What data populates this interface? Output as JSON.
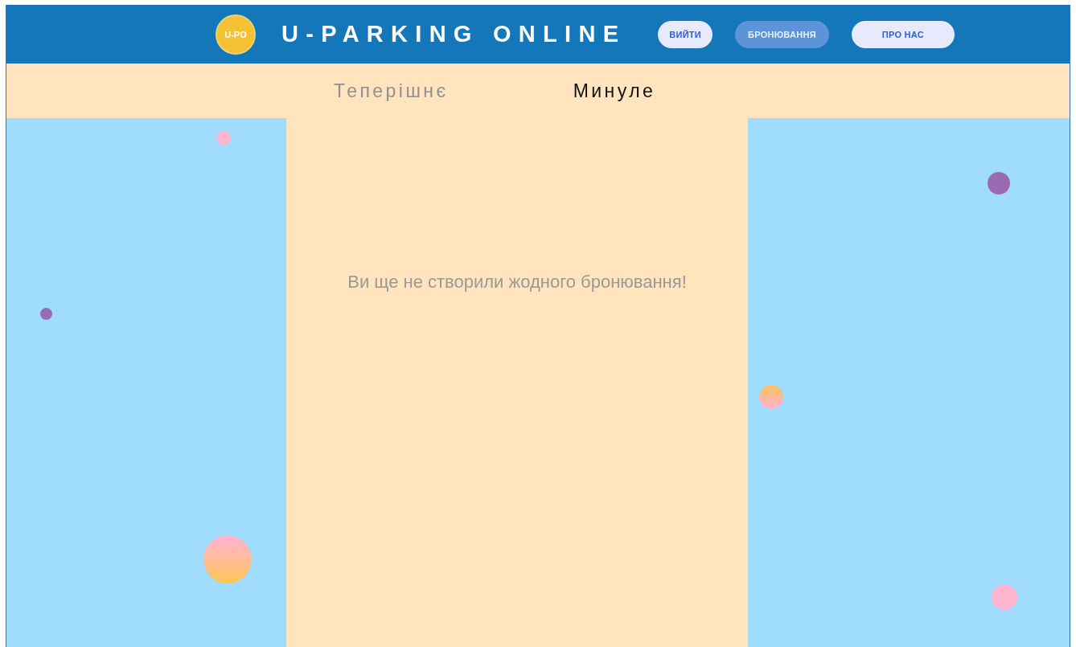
{
  "header": {
    "logo": "U-PO",
    "title": "U-PARKING ONLINE",
    "nav": [
      {
        "label": "ВИЙТИ",
        "selected": false
      },
      {
        "label": "БРОНЮВАННЯ",
        "selected": true
      },
      {
        "label": "ПРО НАС",
        "selected": false
      }
    ]
  },
  "tabs": [
    {
      "label": "Теперішнє",
      "selected": false
    },
    {
      "label": "Минуле",
      "selected": true
    }
  ],
  "empty_message": "Ви ще не створили жодного бронювання!"
}
